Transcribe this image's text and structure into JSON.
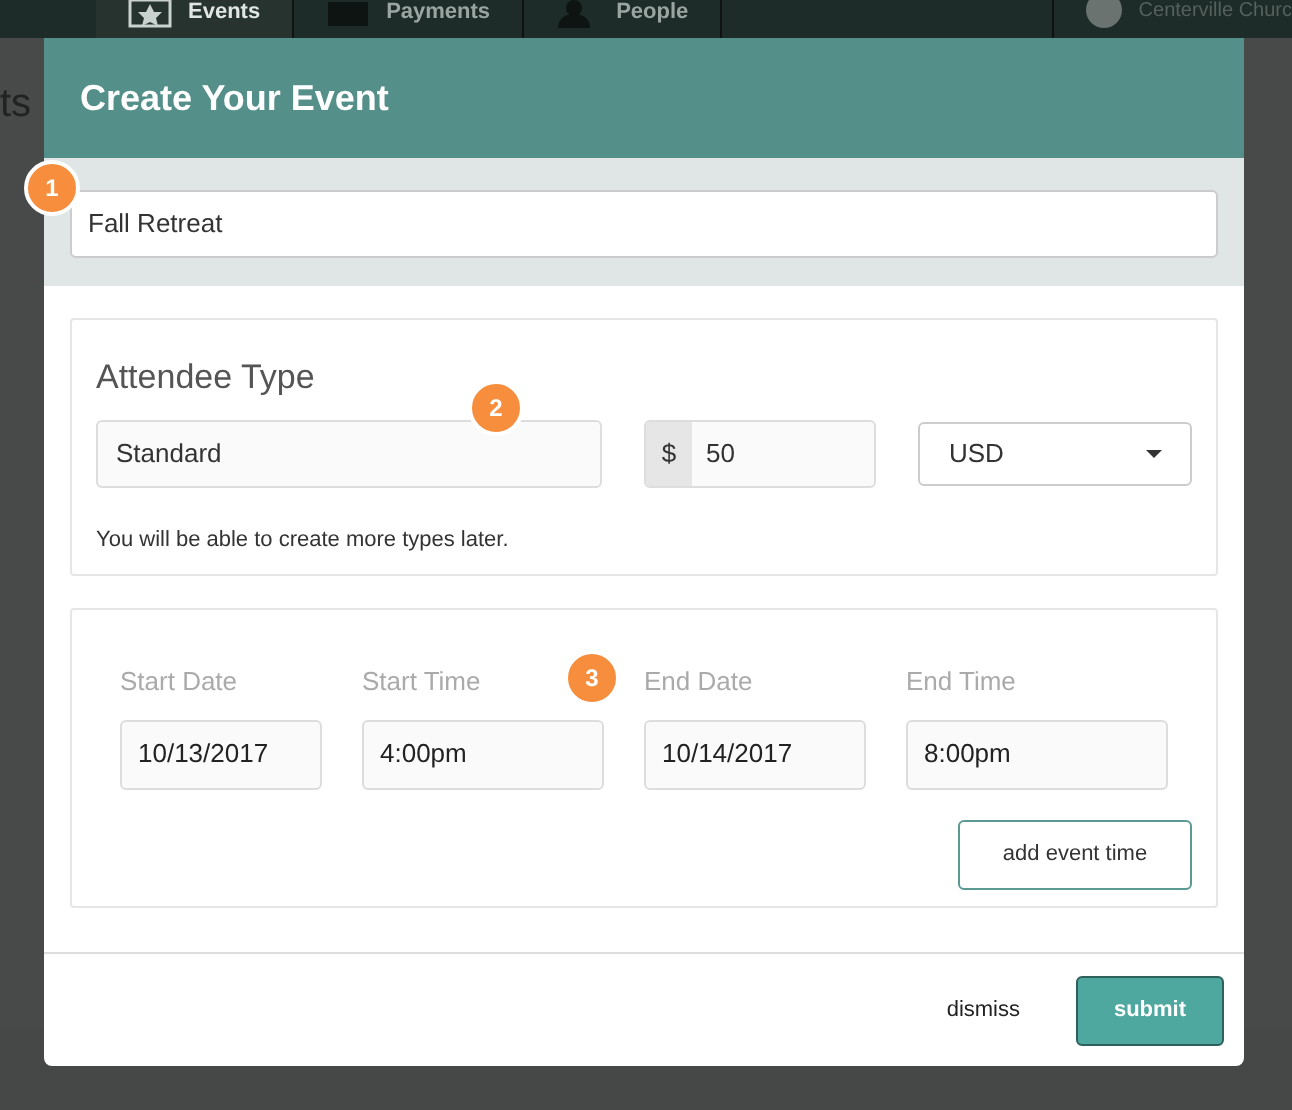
{
  "nav": {
    "items": [
      {
        "label": "Events",
        "selected": true
      },
      {
        "label": "Payments",
        "selected": false
      },
      {
        "label": "People",
        "selected": false
      }
    ],
    "account": "Centerville Churc"
  },
  "page_title_fragment": "ts",
  "modal": {
    "title": "Create Your Event",
    "event_name": {
      "value": "Fall Retreat",
      "step": "1"
    },
    "attendee": {
      "heading": "Attendee Type",
      "step": "2",
      "type_value": "Standard",
      "currency_symbol": "$",
      "price": "50",
      "currency": "USD",
      "note": "You will be able to create more types later."
    },
    "times": {
      "step": "3",
      "fields": [
        {
          "label": "Start Date",
          "value": "10/13/2017"
        },
        {
          "label": "Start Time",
          "value": "4:00pm"
        },
        {
          "label": "End Date",
          "value": "10/14/2017"
        },
        {
          "label": "End Time",
          "value": "8:00pm"
        }
      ],
      "add_button": "add event time"
    },
    "buttons": {
      "dismiss": "dismiss",
      "submit": "submit"
    }
  }
}
